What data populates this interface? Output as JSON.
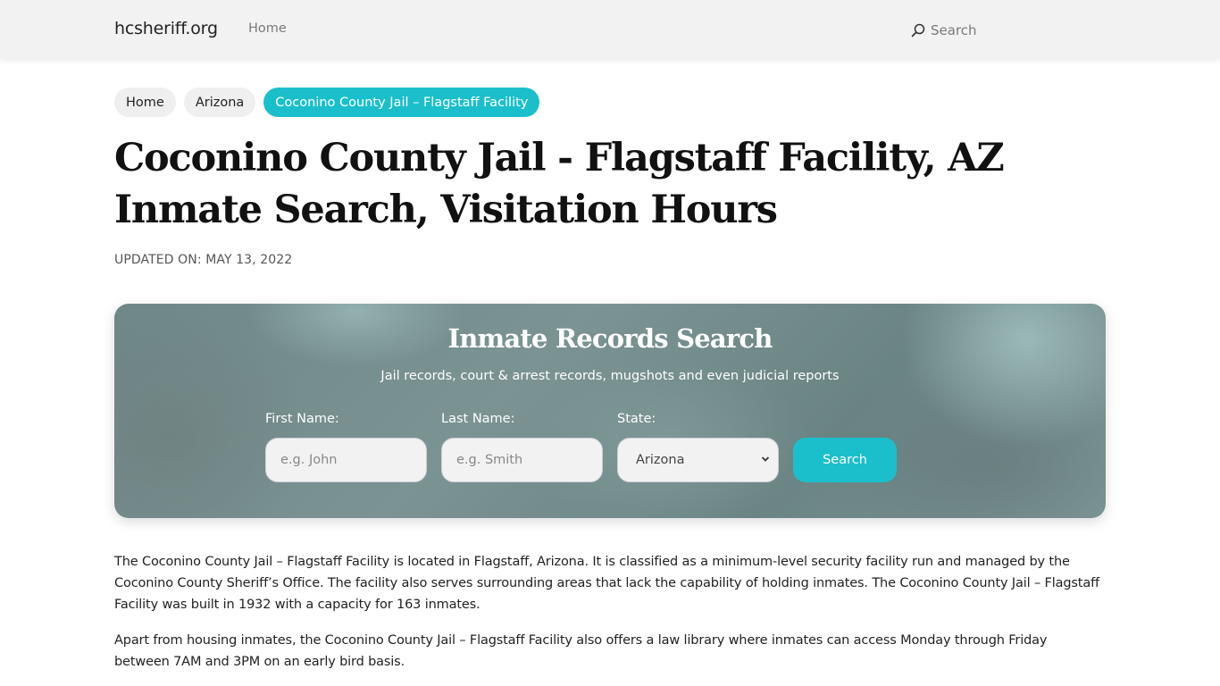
{
  "navbar": {
    "brand": "hcsheriff.org",
    "links": [
      {
        "label": "Home"
      }
    ],
    "search_label": "Search",
    "search_icon": "search-icon"
  },
  "breadcrumb": [
    {
      "label": "Home",
      "active": false
    },
    {
      "label": "Arizona",
      "active": false
    },
    {
      "label": "Coconino County Jail – Flagstaff Facility",
      "active": true
    }
  ],
  "page": {
    "title_line1": "Coconino County Jail - Flagstaff Facility, AZ",
    "title_line2": "Inmate Search, Visitation Hours",
    "updated": "UPDATED ON: MAY 13, 2022"
  },
  "search_card": {
    "title": "Inmate Records Search",
    "subtitle": "Jail records, court & arrest records, mugshots and even judicial reports",
    "first_name": {
      "label": "First Name:",
      "placeholder": "e.g. John",
      "value": ""
    },
    "last_name": {
      "label": "Last Name:",
      "placeholder": "e.g. Smith",
      "value": ""
    },
    "state": {
      "label": "State:",
      "selected": "Arizona"
    },
    "button_label": "Search"
  },
  "content": {
    "paragraphs": [
      "The Coconino County Jail – Flagstaff Facility is located in Flagstaff, Arizona. It is classified as a minimum-level security facility run and managed by the Coconino County Sheriff’s Office. The facility also serves surrounding areas that lack the capability of holding inmates. The Coconino County Jail – Flagstaff Facility was built in 1932 with a capacity for 163 inmates.",
      "Apart from housing inmates, the Coconino County Jail – Flagstaff Facility also offers a law library where inmates can access Monday through Friday between 7AM and 3PM on an early bird basis."
    ]
  },
  "colors": {
    "accent": "#1bbfcb",
    "navbar_bg": "#f2f2f2",
    "card_bg": "#748c8c"
  }
}
